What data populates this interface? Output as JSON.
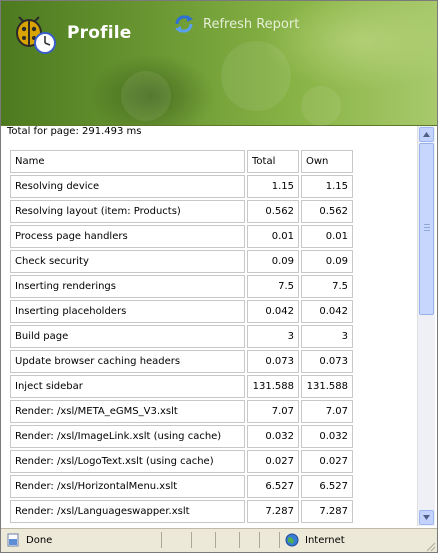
{
  "header": {
    "title": "Profile",
    "refresh_label": "Refresh Report"
  },
  "summary": {
    "total_text": "Total for page: 291.493 ms"
  },
  "table": {
    "columns": [
      "Name",
      "Total",
      "Own"
    ],
    "rows": [
      {
        "name": "Resolving device",
        "total": "1.15",
        "own": "1.15"
      },
      {
        "name": "Resolving layout (item: Products)",
        "total": "0.562",
        "own": "0.562"
      },
      {
        "name": "Process page handlers",
        "total": "0.01",
        "own": "0.01"
      },
      {
        "name": "Check security",
        "total": "0.09",
        "own": "0.09"
      },
      {
        "name": "Inserting renderings",
        "total": "7.5",
        "own": "7.5"
      },
      {
        "name": "Inserting placeholders",
        "total": "0.042",
        "own": "0.042"
      },
      {
        "name": "Build page",
        "total": "3",
        "own": "3"
      },
      {
        "name": "Update browser caching headers",
        "total": "0.073",
        "own": "0.073"
      },
      {
        "name": "Inject sidebar",
        "total": "131.588",
        "own": "131.588"
      },
      {
        "name": "Render: /xsl/META_eGMS_V3.xslt",
        "total": "7.07",
        "own": "7.07"
      },
      {
        "name": "Render: /xsl/ImageLink.xslt (using cache)",
        "total": "0.032",
        "own": "0.032"
      },
      {
        "name": "Render: /xsl/LogoText.xslt (using cache)",
        "total": "0.027",
        "own": "0.027"
      },
      {
        "name": "Render: /xsl/HorizontalMenu.xslt",
        "total": "6.527",
        "own": "6.527"
      },
      {
        "name": "Render: /xsl/Languageswapper.xslt",
        "total": "7.287",
        "own": "7.287"
      }
    ]
  },
  "statusbar": {
    "status": "Done",
    "zone": "Internet"
  },
  "icons": {
    "logo": "bug-clock-icon",
    "refresh": "refresh-icon",
    "done": "page-icon",
    "zone": "globe-icon"
  },
  "colors": {
    "header_dark": "#4d7a1f",
    "header_light": "#a8c96c",
    "status_bg": "#ece9d8"
  }
}
